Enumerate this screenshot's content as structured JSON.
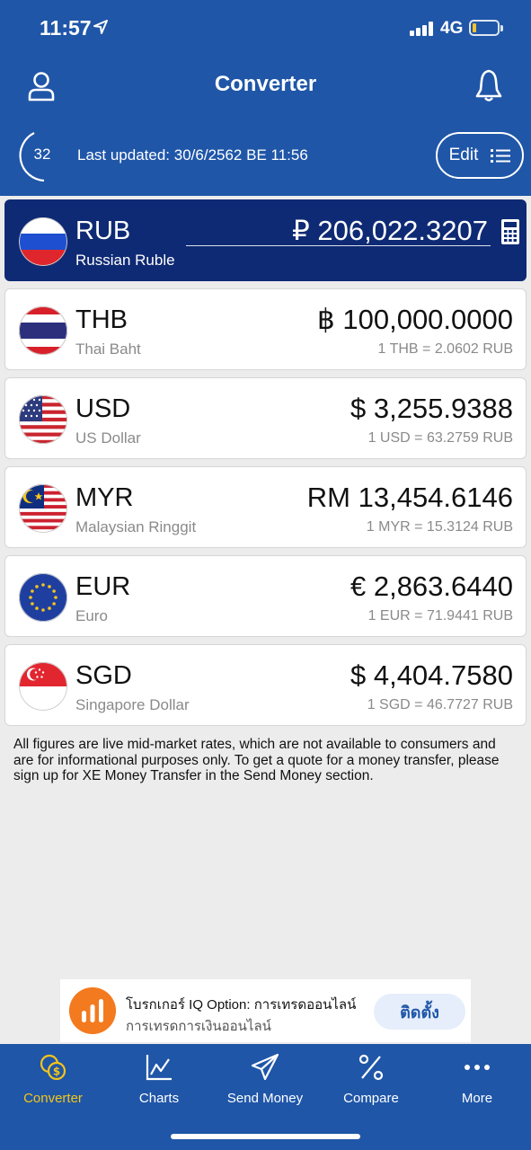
{
  "status_bar": {
    "time": "11:57",
    "network": "4G"
  },
  "header": {
    "title": "Converter",
    "refresh_count": "32",
    "last_updated": "Last updated: 30/6/2562 BE 11:56",
    "edit_label": "Edit"
  },
  "base_currency": {
    "code": "RUB",
    "name": "Russian Ruble",
    "amount": "₽ 206,022.3207"
  },
  "currencies": [
    {
      "code": "THB",
      "name": "Thai Baht",
      "amount": "฿ 100,000.0000",
      "rate": "1 THB = 2.0602 RUB"
    },
    {
      "code": "USD",
      "name": "US Dollar",
      "amount": "$ 3,255.9388",
      "rate": "1 USD = 63.2759 RUB"
    },
    {
      "code": "MYR",
      "name": "Malaysian Ringgit",
      "amount": "RM 13,454.6146",
      "rate": "1 MYR = 15.3124 RUB"
    },
    {
      "code": "EUR",
      "name": "Euro",
      "amount": "€ 2,863.6440",
      "rate": "1 EUR = 71.9441 RUB"
    },
    {
      "code": "SGD",
      "name": "Singapore Dollar",
      "amount": "$ 4,404.7580",
      "rate": "1 SGD = 46.7727 RUB"
    }
  ],
  "disclaimer": "All figures are live mid-market rates, which are not available to consumers and are for informational purposes only. To get a quote for a money transfer, please sign up for XE Money Transfer in the Send Money section.",
  "ad": {
    "title": "โบรกเกอร์ IQ Option: การเทรดออนไลน์",
    "subtitle": "การเทรดการเงินออนไลน์",
    "button": "ติดตั้ง"
  },
  "tabs": [
    {
      "label": "Converter",
      "icon": "coins-icon",
      "active": true
    },
    {
      "label": "Charts",
      "icon": "chart-icon",
      "active": false
    },
    {
      "label": "Send Money",
      "icon": "paper-plane-icon",
      "active": false
    },
    {
      "label": "Compare",
      "icon": "percent-icon",
      "active": false
    },
    {
      "label": "More",
      "icon": "more-dots-icon",
      "active": false
    }
  ],
  "colors": {
    "brand_blue": "#1f56a8",
    "base_card": "#0f2a74",
    "active_tab": "#f5c518"
  }
}
